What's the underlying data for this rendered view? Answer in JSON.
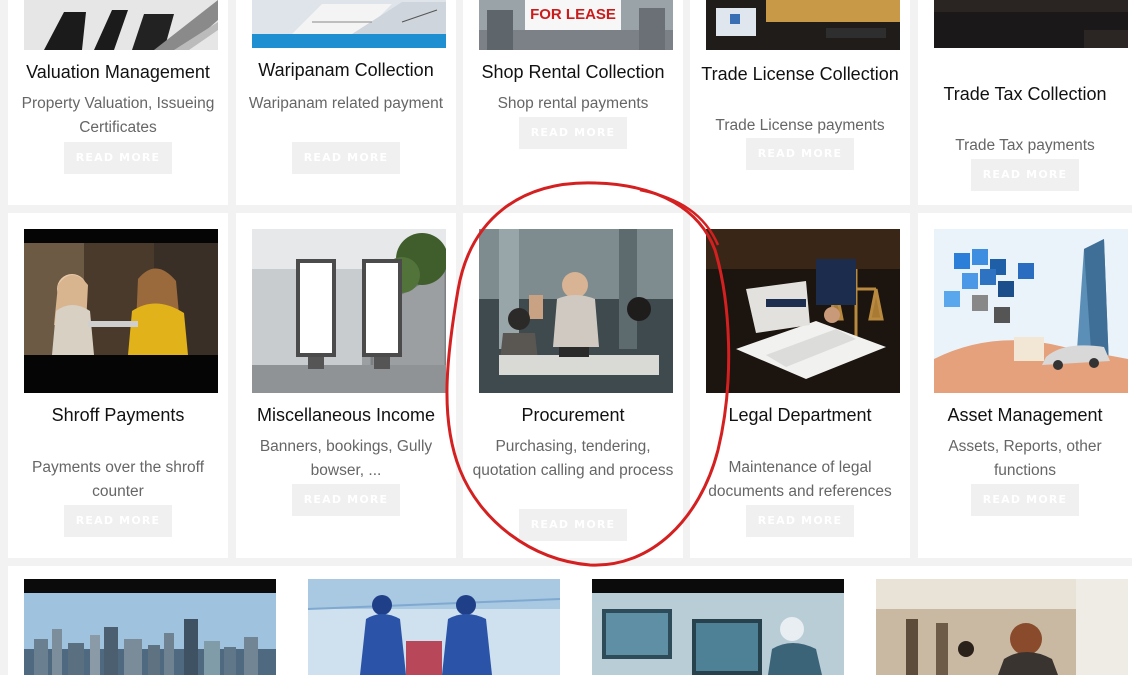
{
  "services": {
    "row1": [
      {
        "title": "Valuation Management",
        "desc": "Property Valuation, Issueing Certificates",
        "button": "READ MORE"
      },
      {
        "title": "Waripanam Collection",
        "desc": "Waripanam related payment",
        "button": "READ MORE"
      },
      {
        "title": "Shop Rental Collection",
        "desc": "Shop rental payments",
        "button": "READ MORE",
        "image_text": "FOR LEASE"
      },
      {
        "title": "Trade License Collection",
        "desc": "Trade License payments",
        "button": "READ MORE"
      },
      {
        "title": "Trade Tax Collection",
        "desc": "Trade Tax payments",
        "button": "READ MORE"
      }
    ],
    "row2": [
      {
        "title": "Shroff Payments",
        "desc": "Payments over the shroff counter",
        "button": "READ MORE"
      },
      {
        "title": "Miscellaneous Income",
        "desc": "Banners, bookings, Gully bowser, ...",
        "button": "READ MORE"
      },
      {
        "title": "Procurement",
        "desc": "Purchasing, tendering, quotation calling and process",
        "button": "READ MORE"
      },
      {
        "title": "Legal Department",
        "desc": "Maintenance of legal documents and references",
        "button": "READ MORE"
      },
      {
        "title": "Asset Management",
        "desc": "Assets, Reports, other functions",
        "button": "READ MORE"
      }
    ]
  },
  "colors": {
    "annotation": "#d42020",
    "button_bg": "#f0f0f0",
    "page_bg": "#f2f2f2"
  }
}
